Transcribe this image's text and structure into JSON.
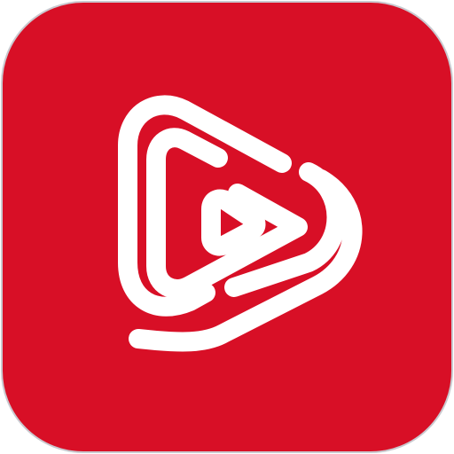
{
  "icon": {
    "name": "play-button-logo-icon",
    "colors": {
      "background": "#D80F26",
      "border": "#C9C9CF",
      "foreground": "#FFFFFF"
    }
  }
}
